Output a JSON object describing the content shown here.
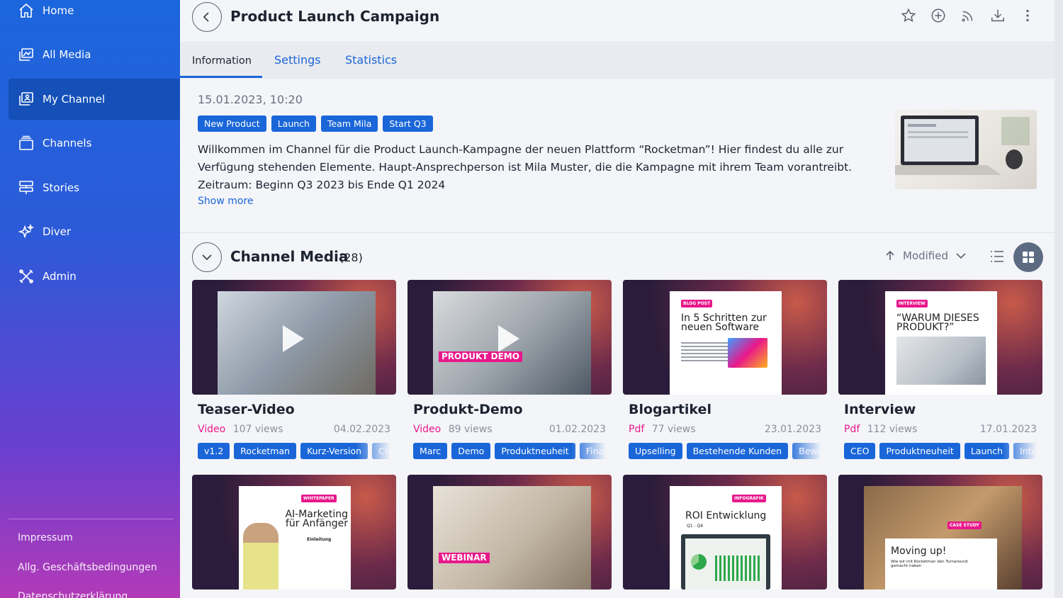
{
  "sidebar": {
    "items": [
      {
        "label": "Home",
        "icon": "home-icon"
      },
      {
        "label": "All Media",
        "icon": "media-icon"
      },
      {
        "label": "My Channel",
        "icon": "channel-icon"
      },
      {
        "label": "Channels",
        "icon": "channels-icon"
      },
      {
        "label": "Stories",
        "icon": "stories-icon"
      },
      {
        "label": "Diver",
        "icon": "sparkle-icon"
      },
      {
        "label": "Admin",
        "icon": "tools-icon"
      }
    ],
    "active_index": 2,
    "footer": [
      "Impressum",
      "Allg. Geschäftsbedingungen",
      "Datenschutzerklärung"
    ]
  },
  "header": {
    "title": "Product Launch Campaign",
    "icons": [
      "star-icon",
      "add-circle-icon",
      "rss-icon",
      "download-icon",
      "more-vert-icon"
    ]
  },
  "tabs": [
    "Information",
    "Settings",
    "Statistics"
  ],
  "active_tab": 0,
  "info": {
    "date": "15.01.2023, 10:20",
    "tags": [
      "New Product",
      "Launch",
      "Team Mila",
      "Start Q3"
    ],
    "description": "Willkommen im Channel für die Product Launch-Kampagne der neuen Plattform “Rocketman”!  Hier findest du alle zur Verfügung stehenden Elemente. Haupt-Ansprechperson ist Mila Muster, die die Kampagne mit ihrem Team vorantreibt. Zeitraum: Beginn Q3 2023 bis Ende Q1 2024",
    "show_more": "Show more"
  },
  "media": {
    "title": "Channel Media",
    "count": "(28)",
    "sort_label": "Modified",
    "cards": [
      {
        "title": "Teaser-Video",
        "type": "Video",
        "views": "107 views",
        "date": "04.02.2023",
        "tags": [
          "v1.2",
          "Rocketman",
          "Kurz-Version",
          "Clip"
        ],
        "thumb": "video"
      },
      {
        "title": "Produkt-Demo",
        "type": "Video",
        "views": "89 views",
        "date": "01.02.2023",
        "tags": [
          "Marc",
          "Demo",
          "Produktneuheit",
          "Final"
        ],
        "thumb": "video",
        "overlay": "PRODUKT DEMO"
      },
      {
        "title": "Blogartikel",
        "type": "Pdf",
        "views": "77 views",
        "date": "23.01.2023",
        "tags": [
          "Upselling",
          "Bestehende Kunden",
          "Bewerbung"
        ],
        "thumb": "doc",
        "badge": "BLOG POST",
        "doc_title": "In 5 Schritten zur neuen Software"
      },
      {
        "title": "Interview",
        "type": "Pdf",
        "views": "112 views",
        "date": "17.01.2023",
        "tags": [
          "CEO",
          "Produktneuheit",
          "Launch",
          "Interview"
        ],
        "thumb": "doc",
        "badge": "INTERVIEW",
        "doc_title": "“WARUM DIESES PRODUKT?”"
      }
    ],
    "row2": [
      {
        "badge": "WHITEPAPER",
        "doc_title": "AI-Marketing für Anfänger",
        "sub": "Einleitung",
        "thumb": "doc"
      },
      {
        "overlay": "WEBINAR",
        "thumb": "photo"
      },
      {
        "badge": "INFOGRAFIK",
        "doc_title": "ROI Entwicklung",
        "sub": "Q1 - Q4",
        "thumb": "doc"
      },
      {
        "badge": "CASE STUDY",
        "doc_title": "Moving up!",
        "sub": "Wie wir mit Rocketman den Turnaround gemacht haben",
        "thumb": "photo-doc"
      }
    ]
  },
  "colors": {
    "accent": "#1a66d8",
    "pink": "#e8188b",
    "sidebar_active": "#1450b8"
  }
}
